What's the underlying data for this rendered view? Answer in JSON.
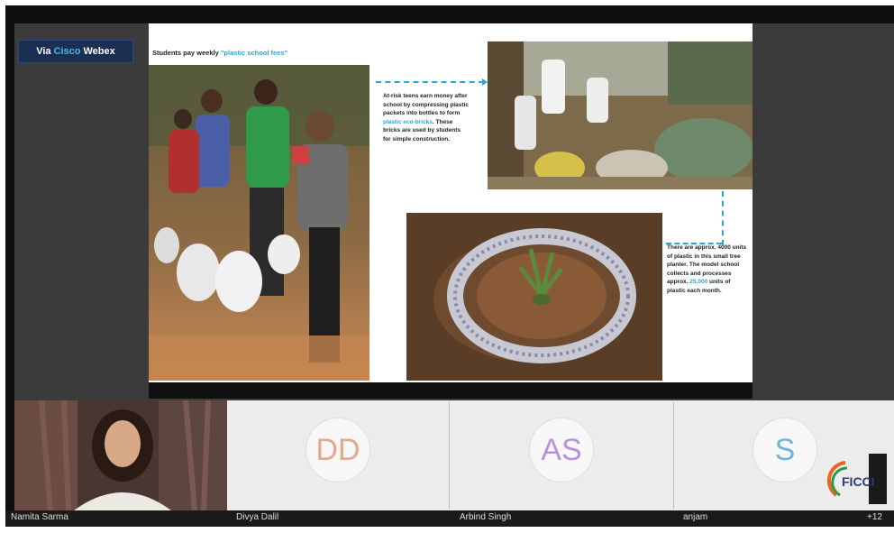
{
  "meeting": {
    "badge": {
      "prefix": "Via ",
      "brand": "Cisco",
      "product": "Webex"
    }
  },
  "slide": {
    "title_prefix": "Students pay weekly ",
    "title_highlight": "\"plastic school fees\"",
    "text1_a": "At-risk teens earn money after school by compressing plastic packets into bottles to form ",
    "text1_hl": "plastic eco-bricks",
    "text1_b": ". These bricks are used by students for simple construction.",
    "text2_a": "There are approx. 4000 units of plastic in this small tree planter. The model school collects and processes approx. ",
    "text2_hl": "25,000",
    "text2_b": " units of plastic each month."
  },
  "participants": [
    {
      "name": "Namita Sarma",
      "initials": "",
      "video": true
    },
    {
      "name": "Divya Dalil",
      "initials": "DD",
      "color": "#e2a98a"
    },
    {
      "name": "Arbind Singh",
      "initials": "AS",
      "color": "#b892d8"
    },
    {
      "name": "anjam",
      "initials": "S",
      "color": "#6fb4dc"
    }
  ],
  "overflow_count": "+12",
  "logo": {
    "text": "FICCI"
  }
}
